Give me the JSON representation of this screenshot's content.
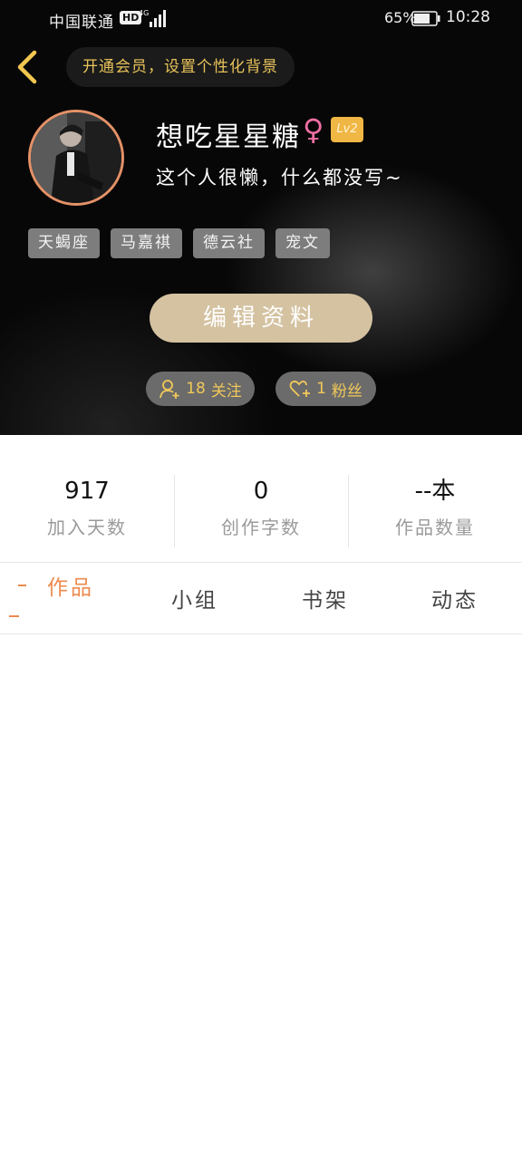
{
  "status_bar": {
    "carrier": "中国联通",
    "hd_badge": "HD",
    "battery_percent": "65%",
    "time": "10:28"
  },
  "header": {
    "vip_banner": "开通会员，设置个性化背景",
    "nickname": "想吃星星糖",
    "gender_symbol": "♀",
    "level": "Lv2",
    "bio": "这个人很懒，什么都没写~",
    "tags": [
      "天蝎座",
      "马嘉祺",
      "德云社",
      "宠文"
    ],
    "edit_button": "编辑资料",
    "follow_count": "18",
    "follow_label": "关注",
    "fans_count": "1",
    "fans_label": "粉丝"
  },
  "stats": [
    {
      "value": "917",
      "label": "加入天数"
    },
    {
      "value": "0",
      "label": "创作字数"
    },
    {
      "value": "--本",
      "label": "作品数量"
    }
  ],
  "tabs": [
    {
      "label": "作品",
      "active": true
    },
    {
      "label": "小组",
      "active": false
    },
    {
      "label": "书架",
      "active": false
    },
    {
      "label": "动态",
      "active": false
    }
  ],
  "colors": {
    "accent": "#ed8a4e",
    "gold": "#e8c35a",
    "level_badge": "#f0b744",
    "edit_button": "#d4c2a1",
    "gender": "#ee6fa3"
  }
}
